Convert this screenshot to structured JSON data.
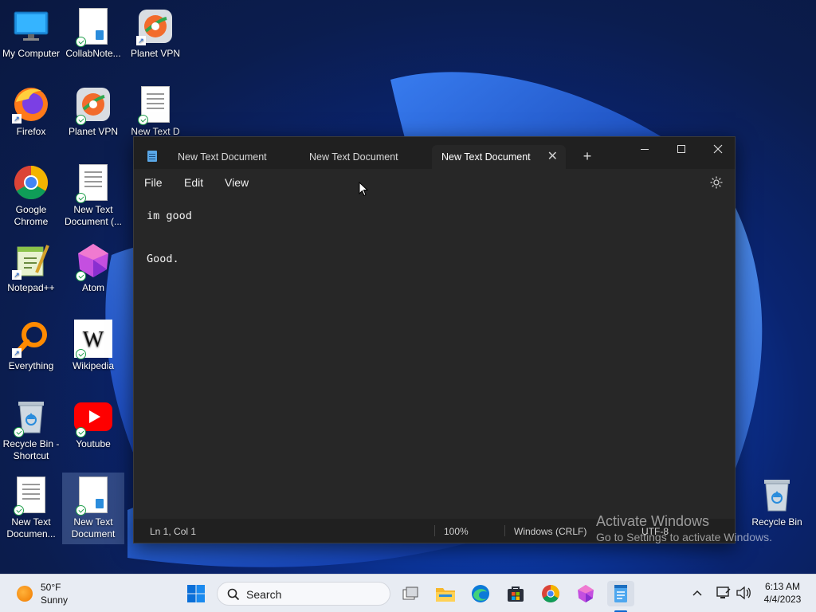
{
  "desktop": {
    "icons": [
      {
        "label": "My Computer",
        "icon": "monitor-icon"
      },
      {
        "label": "CollabNote...",
        "icon": "document-icon"
      },
      {
        "label": "Planet VPN",
        "icon": "planet-vpn-icon"
      },
      {
        "label": "Firefox",
        "icon": "firefox-icon"
      },
      {
        "label": "Planet VPN",
        "icon": "planet-vpn-icon"
      },
      {
        "label": "New Text D",
        "icon": "document-icon"
      },
      {
        "label": "Google Chrome",
        "icon": "chrome-icon"
      },
      {
        "label": "New Text Document (...",
        "icon": "document-icon"
      },
      {
        "label": "Notepad++",
        "icon": "notepadpp-icon"
      },
      {
        "label": "Atom",
        "icon": "atom-icon"
      },
      {
        "label": "Everything",
        "icon": "everything-icon"
      },
      {
        "label": "Wikipedia",
        "icon": "wikipedia-icon"
      },
      {
        "label": "Recycle Bin - Shortcut",
        "icon": "recycle-bin-icon"
      },
      {
        "label": "Youtube",
        "icon": "youtube-icon"
      },
      {
        "label": "New Text Documen...",
        "icon": "document-icon"
      },
      {
        "label": "New Text Document",
        "icon": "document-icon"
      },
      {
        "label": "Recycle Bin",
        "icon": "recycle-bin-icon"
      }
    ],
    "watermark": {
      "title": "Activate Windows",
      "subtitle": "Go to Settings to activate Windows."
    }
  },
  "notepad": {
    "tabs": [
      {
        "label": "New Text Document"
      },
      {
        "label": "New Text Document"
      },
      {
        "label": "New Text Document"
      }
    ],
    "tab_close": "✕",
    "new_tab": "+",
    "menu": [
      "File",
      "Edit",
      "View"
    ],
    "content": {
      "lines": [
        "im good",
        "",
        "",
        "Good."
      ]
    },
    "status": {
      "position": "Ln 1, Col 1",
      "zoom": "100%",
      "line_ending": "Windows (CRLF)",
      "encoding": "UTF-8"
    }
  },
  "taskbar": {
    "weather": {
      "temp": "50°F",
      "condition": "Sunny"
    },
    "search_label": "Search",
    "clock": {
      "time": "6:13 AM",
      "date": "4/4/2023"
    },
    "apps": [
      "start-icon",
      "task-view-icon",
      "file-explorer-icon",
      "edge-icon",
      "store-icon",
      "chrome-icon",
      "atom-icon",
      "notepad-icon"
    ]
  },
  "colors": {
    "editor_bg": "#272727",
    "titlebar_bg": "#202020",
    "taskbar_bg": "#e8ecf3",
    "accent": "#0b66d0"
  }
}
